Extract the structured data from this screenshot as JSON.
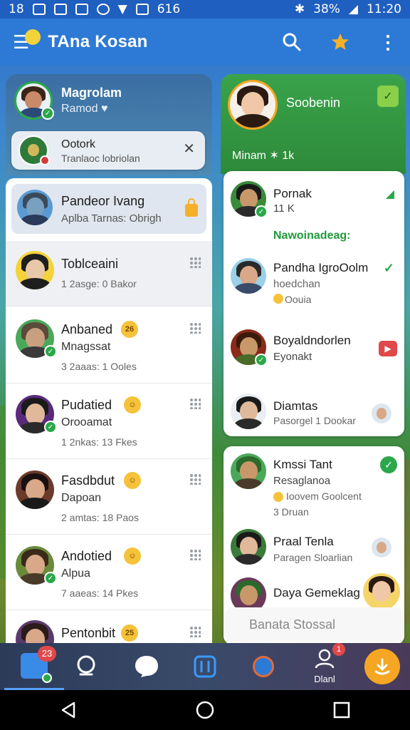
{
  "status_bar": {
    "time_left": "18",
    "battery": "38%",
    "clock": "11:20",
    "extra": "616"
  },
  "app": {
    "title": "TAna Kosan"
  },
  "profile": {
    "name": "Magrolam",
    "sub": "Ramod ♥"
  },
  "notification": {
    "title": "Ootork",
    "subtitle": "Tranlaoc lobriolan"
  },
  "chats_left": [
    {
      "name": "Pandeor Ivang",
      "sub": "Aplba Tarnas: Obrigh"
    },
    {
      "name": "Toblceaini",
      "meta": "1 2asge: 0 Bakor"
    },
    {
      "name": "Anbaned",
      "sub": "Mnagssat",
      "meta": "3 2aaas: 1 Ooles",
      "emoji": "26"
    },
    {
      "name": "Pudatied",
      "sub": "Orooamat",
      "meta": "1 2nkas: 13 Fkes"
    },
    {
      "name": "Fasdbdut",
      "sub": "Dapoan",
      "meta": "2 amtas: 18 Paos"
    },
    {
      "name": "Andotied",
      "sub": "Alpua",
      "meta": "7 aaeas: 14 Pkes"
    },
    {
      "name": "Pentonbit",
      "emoji": "25"
    }
  ],
  "right_header": {
    "name": "Soobenin",
    "label": "Minam ✶ 1k"
  },
  "chats_right_group1": [
    {
      "name": "Pornak",
      "sub": "11 K",
      "green": "Nawoinadeag:"
    },
    {
      "name": "Pandha IgroOolm",
      "sub": "hoedchan",
      "meta": "Oouia"
    },
    {
      "name": "Boyaldndorlen",
      "sub": "Eyonakt"
    },
    {
      "name": "Diamtas",
      "sub": "Pasorgel 1 Dookar"
    }
  ],
  "chats_right_group2": [
    {
      "name": "Kmssi Tant",
      "sub": "Resaglanoa",
      "meta": "Ioovem Goolcent",
      "meta2": "3 Druan"
    },
    {
      "name": "Praal Tenla",
      "sub": "Paragen Sloarlian"
    },
    {
      "name": "Daya Gemeklag"
    }
  ],
  "compose": {
    "placeholder": "Banata Stossal"
  },
  "bottom_nav": {
    "badge_count": "23",
    "contacts_badge": "1",
    "contacts_label": "Dlanl"
  },
  "colors": {
    "appbar": "#2d7ad6",
    "status": "#1f5fbf",
    "accent_orange": "#f5a623",
    "green": "#2aa84a"
  },
  "icons": [
    "menu-icon",
    "search-icon",
    "star-icon",
    "more-icon",
    "close-icon",
    "chat-icon",
    "search-nav-icon",
    "bubble-icon",
    "book-icon",
    "location-icon",
    "contacts-icon",
    "download-icon",
    "back-icon",
    "home-icon",
    "recents-icon"
  ]
}
